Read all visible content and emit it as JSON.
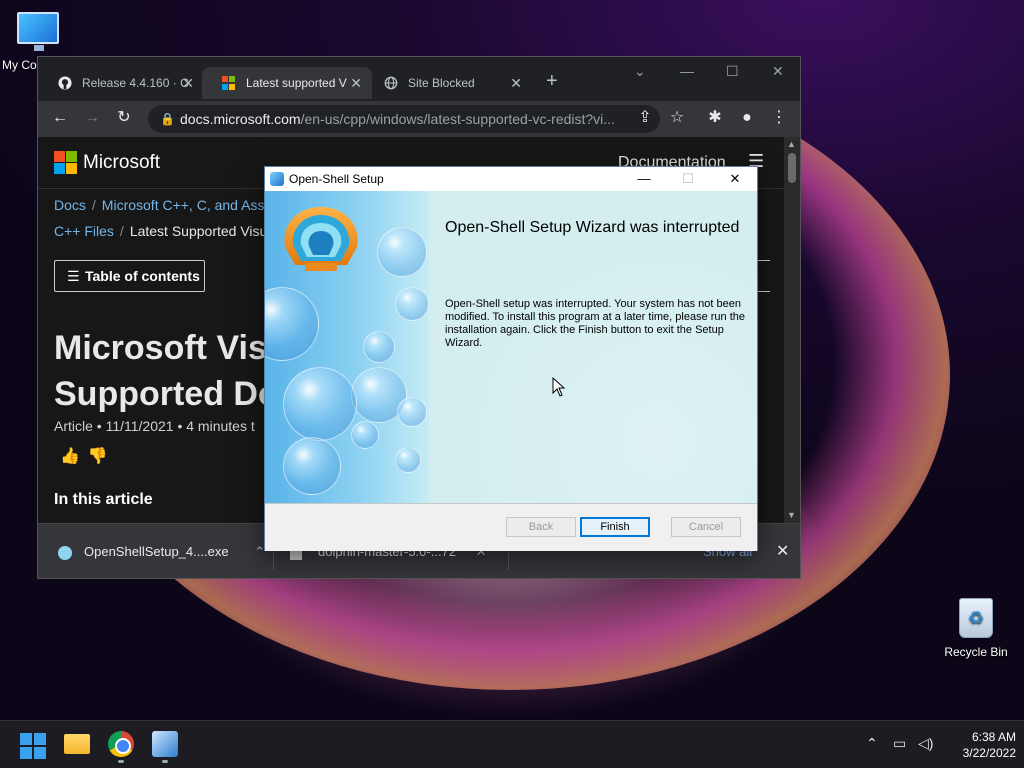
{
  "desktop": {
    "icons": [
      {
        "label": "My Co"
      },
      {
        "label": "Recycle Bin"
      }
    ]
  },
  "browser": {
    "tabs": [
      {
        "label": "Release 4.4.160 · C",
        "icon": "github-icon",
        "active": false
      },
      {
        "label": "Latest supported V",
        "icon": "microsoft-icon",
        "active": true
      },
      {
        "label": "Site Blocked",
        "icon": "globe-icon",
        "active": false
      }
    ],
    "new_tab_glyph": "+",
    "window_controls": {
      "minimize": "—",
      "maximize": "☐",
      "close": "✕"
    },
    "address": {
      "host": "docs.microsoft.com",
      "path": "/en-us/cpp/windows/latest-supported-vc-redist?vi..."
    },
    "page": {
      "brand": "Microsoft",
      "documentation_link": "Documentation",
      "breadcrumb_row1": [
        "Docs",
        "Microsoft C++, C, and Ass"
      ],
      "breadcrumb_row2": [
        "C++ Files",
        "Latest Supported Visu"
      ],
      "toc_button": "Table of contents",
      "title_line1": "Microsoft Visu",
      "title_line2": "Supported Do",
      "meta": "Article • 11/11/2021 • 4 minutes t",
      "in_this_article": "In this article"
    },
    "downloads": {
      "items": [
        {
          "name": "OpenShellSetup_4....exe"
        },
        {
          "name": "dolphin-master-5.0-...72"
        }
      ],
      "show_all": "Show all"
    }
  },
  "dialog": {
    "title": "Open-Shell Setup",
    "heading": "Open-Shell Setup Wizard was interrupted",
    "message": "Open-Shell setup was interrupted. Your system has not been modified. To install this program at a later time, please run the installation again. Click the Finish button to exit the Setup Wizard.",
    "buttons": {
      "back": "Back",
      "finish": "Finish",
      "cancel": "Cancel"
    }
  },
  "taskbar": {
    "time": "6:38 AM",
    "date": "3/22/2022"
  },
  "colors": {
    "accent": "#0078d7",
    "chrome_dark": "#202124",
    "link_blue": "#75b6e7"
  }
}
